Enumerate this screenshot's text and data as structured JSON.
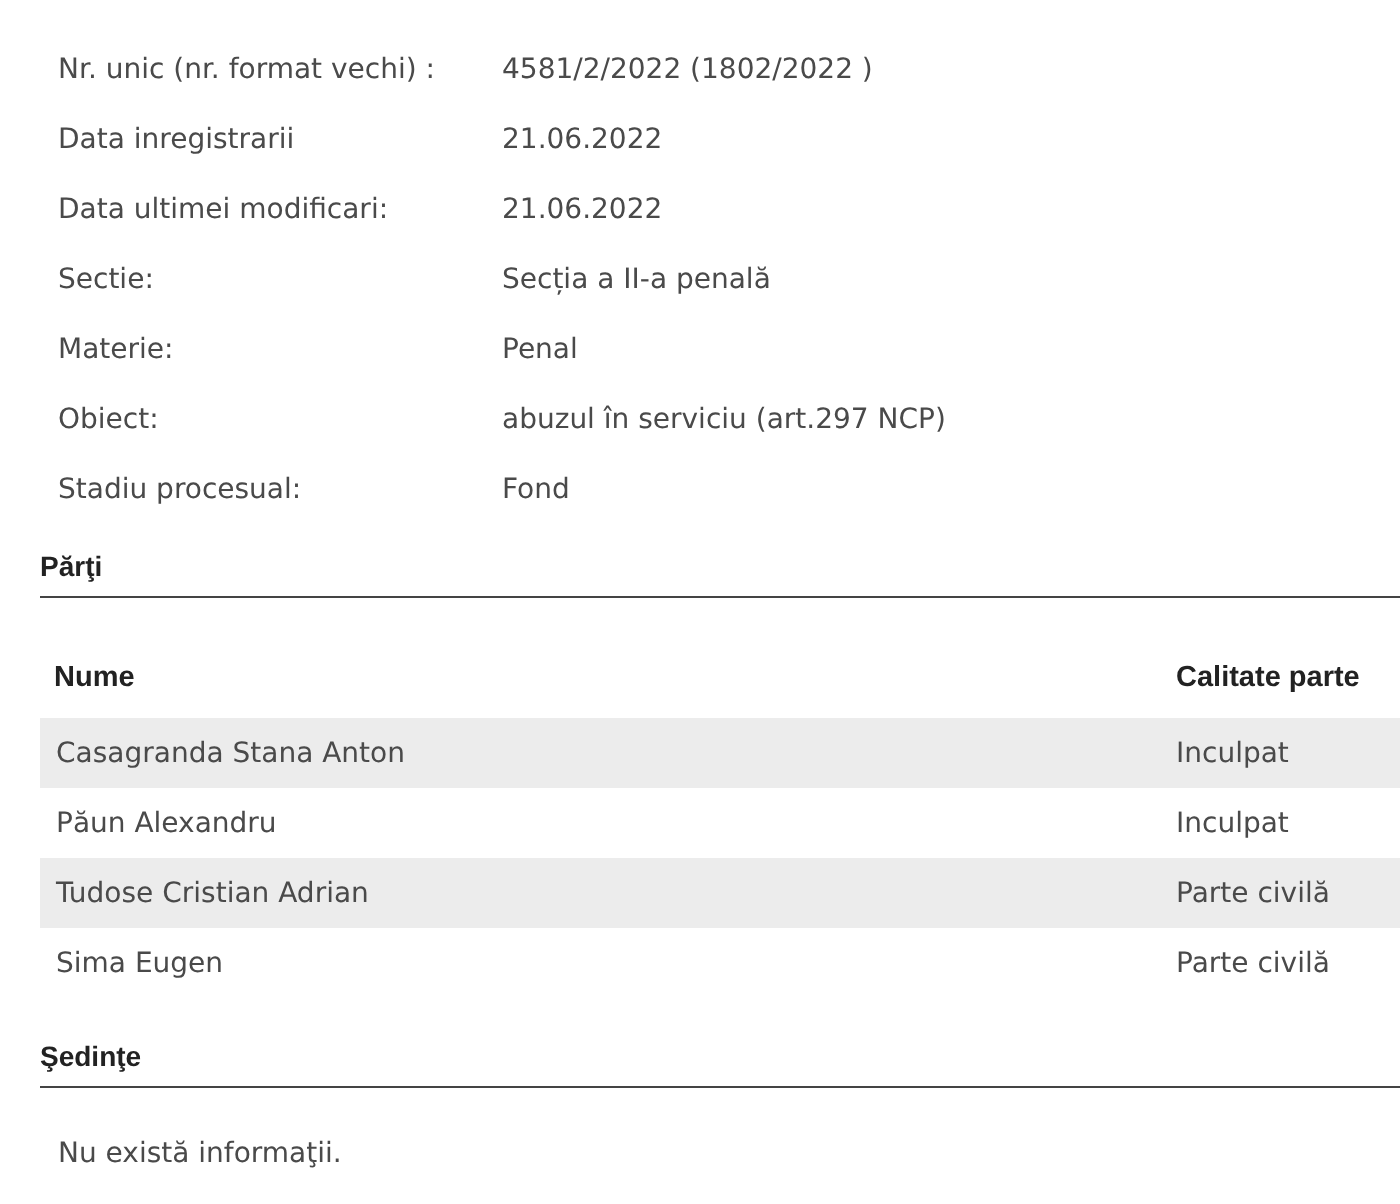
{
  "details": [
    {
      "label": "Nr. unic (nr. format vechi) :",
      "value": "4581/2/2022 (1802/2022 )"
    },
    {
      "label": "Data inregistrarii",
      "value": "21.06.2022"
    },
    {
      "label": "Data ultimei modificari:",
      "value": "21.06.2022"
    },
    {
      "label": "Sectie:",
      "value": "Secția a II-a penală"
    },
    {
      "label": "Materie:",
      "value": "Penal"
    },
    {
      "label": "Obiect:",
      "value": "abuzul în serviciu (art.297 NCP)"
    },
    {
      "label": "Stadiu procesual:",
      "value": "Fond"
    }
  ],
  "parties": {
    "title": "Părţi",
    "columns": [
      "Nume",
      "Calitate parte"
    ],
    "rows": [
      {
        "name": "Casagranda Stana Anton",
        "role": "Inculpat"
      },
      {
        "name": "Păun Alexandru",
        "role": "Inculpat"
      },
      {
        "name": "Tudose Cristian Adrian",
        "role": "Parte civilă"
      },
      {
        "name": "Sima Eugen",
        "role": "Parte civilă"
      }
    ]
  },
  "hearings": {
    "title": "Şedinţe",
    "message": "Nu există informaţii."
  }
}
